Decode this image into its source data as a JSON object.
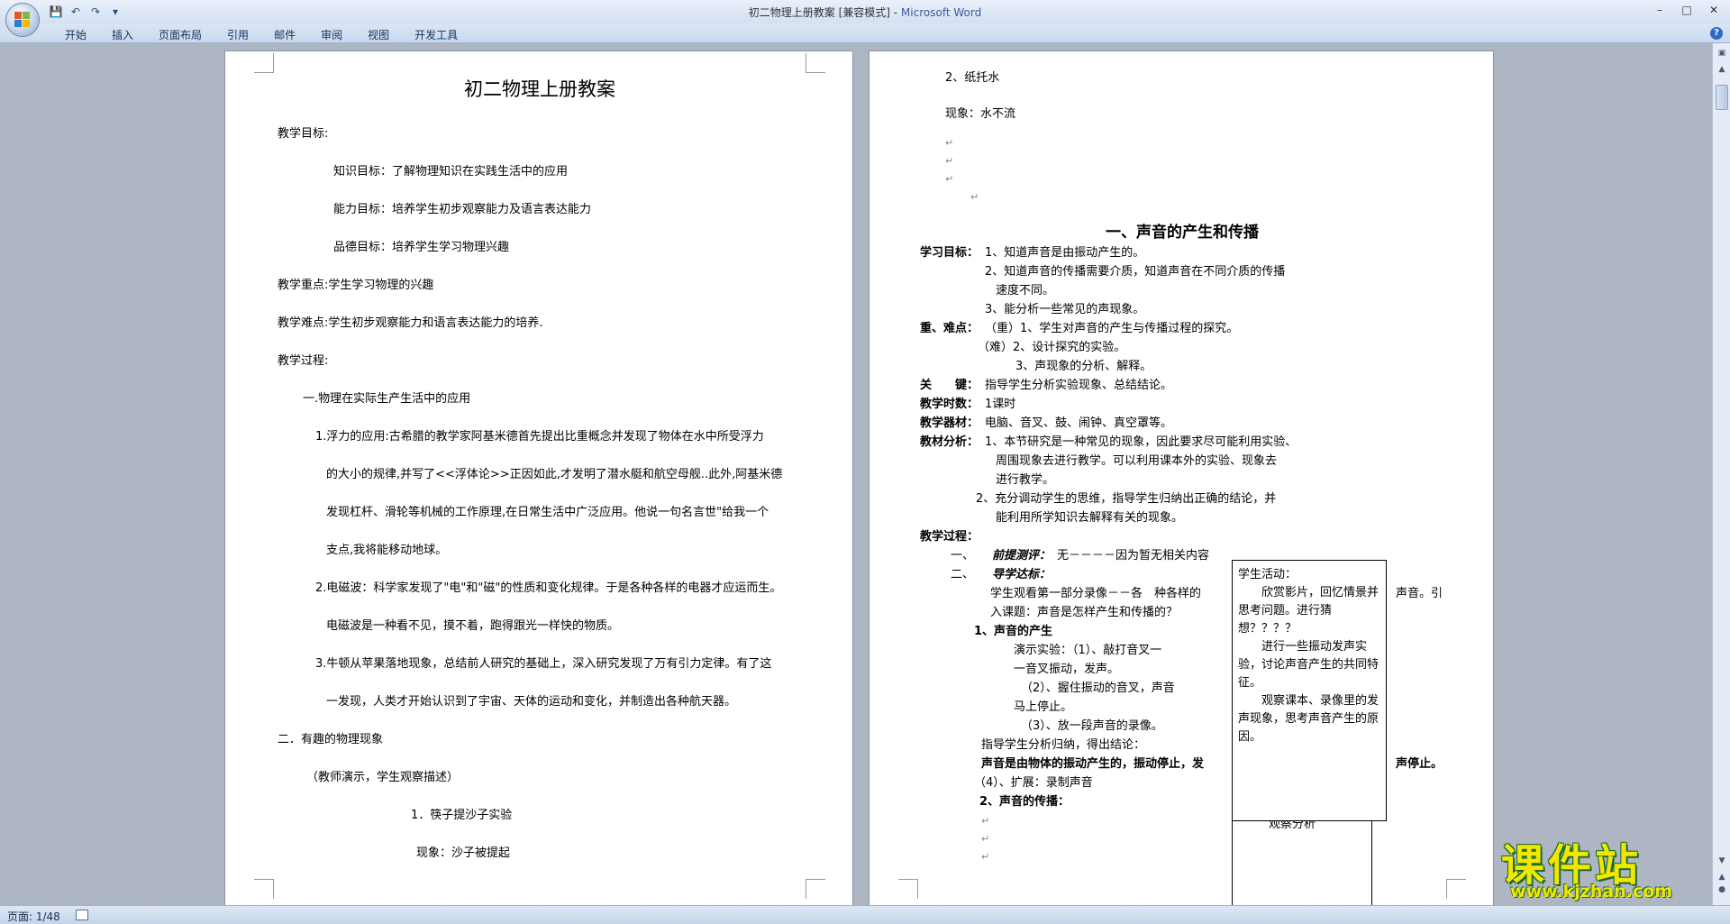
{
  "window": {
    "title": "初二物理上册教案 [兼容模式] - ",
    "app_name": "Microsoft Word",
    "quick_access": [
      "save-icon",
      "undo-icon",
      "redo-icon",
      "customize-icon"
    ]
  },
  "ribbon": {
    "tabs": [
      "开始",
      "插入",
      "页面布局",
      "引用",
      "邮件",
      "审阅",
      "视图",
      "开发工具"
    ],
    "help": "?"
  },
  "page1": {
    "title": "初二物理上册教案",
    "lines": [
      "教学目标:",
      "知识目标：了解物理知识在实践生活中的应用",
      "能力目标：培养学生初步观察能力及语言表达能力",
      "品德目标：培养学生学习物理兴趣",
      "教学重点:学生学习物理的兴趣",
      "教学难点:学生初步观察能力和语言表达能力的培养.",
      "教学过程:",
      "一.物理在实际生产生活中的应用",
      "1.浮力的应用:古希腊的教学家阿基米德首先提出比重概念并发现了物体在水中所受浮力",
      "的大小的规律,并写了<<浮体论>>正因如此,才发明了潜水艇和航空母舰..此外,阿基米德",
      "发现杠杆、滑轮等机械的工作原理,在日常生活中广泛应用。他说一句名言世\"给我一个",
      "支点,我将能移动地球。",
      "2.电磁波：科学家发现了\"电\"和\"磁\"的性质和变化规律。于是各种各样的电器才应运而生。",
      "电磁波是一种看不见，摸不着，跑得跟光一样快的物质。",
      "3.牛顿从苹果落地现象，总结前人研究的基础上，深入研究发现了万有引力定律。有了这",
      "一发现，人类才开始认识到了宇宙、天体的运动和变化，并制造出各种航天器。",
      "二．有趣的物理现象",
      "（教师演示，学生观察描述）",
      "1．筷子提沙子实验",
      "现象：沙子被提起"
    ]
  },
  "page2": {
    "top_lines": [
      "2、纸托水",
      "现象：水不流"
    ],
    "section_title": "一、声音的产生和传播",
    "lines": [
      {
        "label": "学习目标：",
        "text": "1、知道声音是由振动产生的。"
      },
      {
        "label": "",
        "text": "2、知道声音的传播需要介质，知道声音在不同介质的传播"
      },
      {
        "label": "",
        "text": "速度不同。"
      },
      {
        "label": "",
        "text": "3、能分析一些常见的声现象。"
      },
      {
        "label": "重、难点：",
        "text": "（重）1、学生对声音的产生与传播过程的探究。"
      },
      {
        "label": "",
        "text": "（难）2、设计探究的实验。"
      },
      {
        "label": "",
        "text": "3、声现象的分析、解释。"
      },
      {
        "label": "关　　键：",
        "text": "指导学生分析实验现象、总结结论。"
      },
      {
        "label": "教学时数：",
        "text": "1课时"
      },
      {
        "label": "教学器材：",
        "text": "电脑、音叉、鼓、闹钟、真空罩等。"
      },
      {
        "label": "教材分析：",
        "text": "1、本节研究是一种常见的现象，因此要求尽可能利用实验、"
      },
      {
        "label": "",
        "text": "周围现象去进行教学。可以利用课本外的实验、现象去"
      },
      {
        "label": "",
        "text": "进行教学。"
      },
      {
        "label": "",
        "text": "2、充分调动学生的思维，指导学生归纳出正确的结论，并"
      },
      {
        "label": "",
        "text": "能利用所学知识去解释有关的现象。"
      },
      {
        "label": "教学过程：",
        "text": ""
      }
    ],
    "process": {
      "item1_num": "一、",
      "item1_label": "前提测评：",
      "item1_text": "无－－－－因为暂无相关内容",
      "item2_num": "二、",
      "item2_label": "导学达标：",
      "intro1": "学生观看第一部分录像－－各　种各样的",
      "intro1_tail": "声音。引",
      "intro2": "入课题：声音是怎样产生和传播的？",
      "sub1": "1、声音的产生",
      "demo": [
        "演示实验：（1）、敲打音叉一",
        "一音叉振动，发声。",
        "（2）、握住振动的音叉，声音",
        "马上停止。",
        "（3）、放一段声音的录像。"
      ],
      "guide": "指导学生分析归纳，得出结论：",
      "conclusion": "声音是由物体的振动产生的，振动停止，发",
      "conclusion_tail": "声停止。",
      "ext": "（4）、扩展：录制声音",
      "sub2": "2、声音的传播：",
      "below_box": "观察分析"
    },
    "textbox": {
      "title": "学生活动：",
      "p1": "欣赏影片，回忆情景并思考问题。进行猜想？？？？",
      "p2": "进行一些振动发声实验，讨论声音产生的共同特征。",
      "p3": "观察课本、录像里的发声现象，思考声音产生的原因。"
    }
  },
  "status": {
    "page": "页面: 1/48"
  },
  "watermark": {
    "main": "课件站",
    "url": "www.kjzhan.com"
  }
}
